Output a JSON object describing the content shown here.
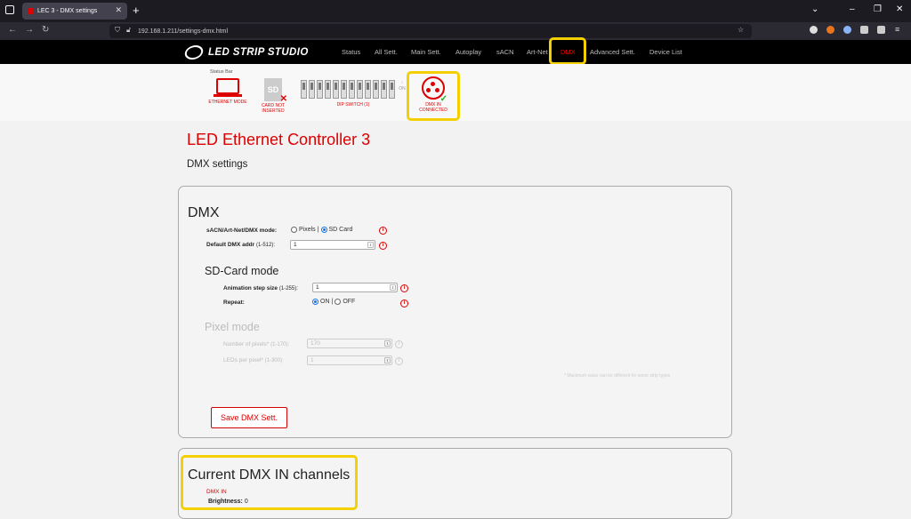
{
  "browser": {
    "tab_title": "LEC 3 - DMX settings",
    "url": "192.168.1.211/settings-dmx.html"
  },
  "nav": {
    "brand": "LED STRIP STUDIO",
    "items": [
      "Status",
      "All Sett.",
      "Main Sett.",
      "Autoplay",
      "sACN",
      "Art-Net",
      "DMX",
      "Advanced Sett.",
      "Device List"
    ],
    "active": "DMX"
  },
  "statusbar": {
    "title": "Status Bar",
    "ethernet": "ETHERNET MODE",
    "card": "CARD NOT INSERTED",
    "card_glyph": "SD",
    "dip": "DIP SWITCH (1)",
    "dip_on": "ON",
    "dmx": "DMX IN CONNECTED"
  },
  "page": {
    "title": "LED Ethernet Controller 3",
    "subtitle": "DMX settings"
  },
  "dmx": {
    "heading": "DMX",
    "mode_label": "sACN/Art-Net/DMX mode:",
    "mode_options": [
      "Pixels",
      "SD Card"
    ],
    "mode_selected": "SD Card",
    "addr_label": "Default DMX addr",
    "addr_range": "(1-512):",
    "addr_value": "1",
    "sd_heading": "SD-Card mode",
    "step_label": "Animation step size",
    "step_range": "(1-255):",
    "step_value": "1",
    "repeat_label": "Repeat:",
    "repeat_options": [
      "ON",
      "OFF"
    ],
    "repeat_selected": "ON",
    "pixel_heading": "Pixel mode",
    "pixels_label": "Number of pixels*",
    "pixels_range": "(1-170):",
    "pixels_value": "170",
    "leds_label": "LEDs per pixel*",
    "leds_range": "(1-300):",
    "leds_value": "1",
    "note": "* Maximum value can be different for some strip types",
    "save_button": "Save DMX Sett."
  },
  "current": {
    "heading": "Current DMX IN channels",
    "dmx_in": "DMX IN",
    "brightness_label": "Brightness:",
    "brightness_value": "0"
  },
  "icons": {
    "highlight_color": "#f5d000",
    "accent": "#dd0000"
  }
}
